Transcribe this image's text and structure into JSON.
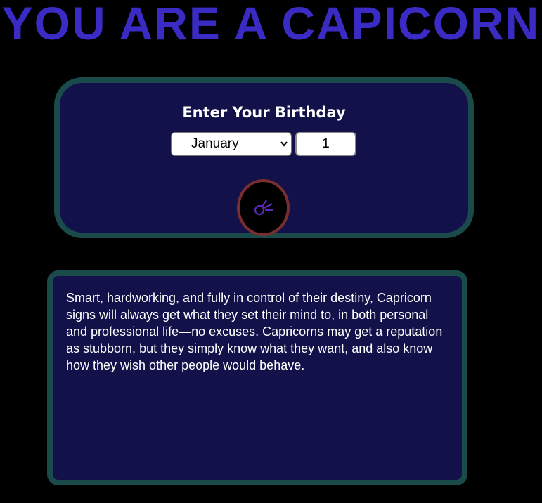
{
  "header": {
    "title": "YOU ARE A CAPICORN",
    "title_color": "#3a2bc4"
  },
  "birthday_form": {
    "heading": "Enter Your Birthday",
    "month_value": "January",
    "day_value": "1",
    "submit_icon": "comet-icon"
  },
  "description": {
    "text": "Smart, hardworking, and fully in control of their destiny, Capricorn signs will always get what they set their mind to, in both personal and professional life—no excuses. Capricorns may get a reputation as stubborn, but they simply know what they want, and also know how they wish other people would behave."
  },
  "colors": {
    "background": "#000000",
    "panel_fill": "#13114a",
    "panel_border": "#1a4a4a",
    "button_border": "#7a2e2e",
    "icon_color": "#5a2bb0"
  }
}
